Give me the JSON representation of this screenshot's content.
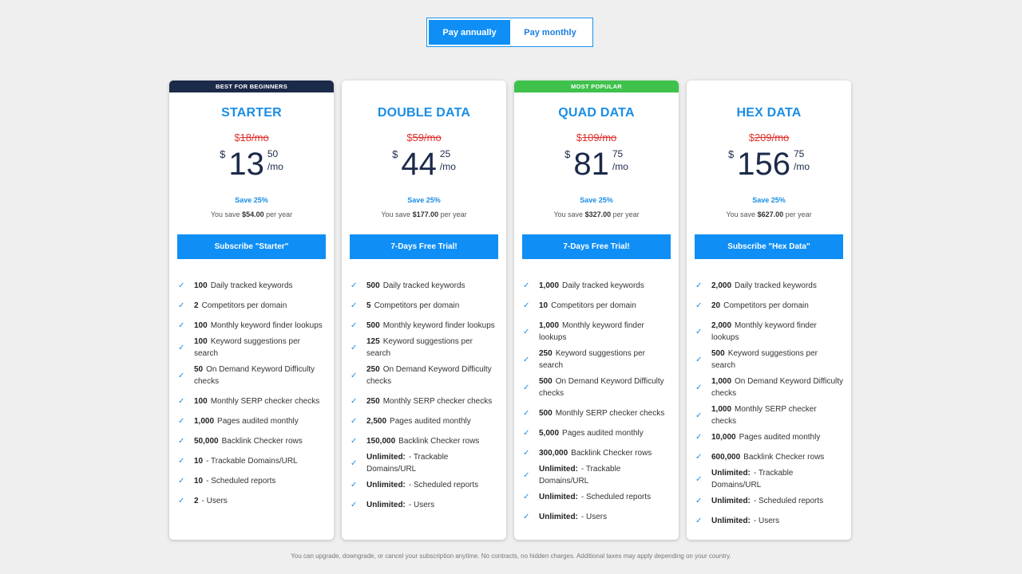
{
  "toggle": {
    "annual": "Pay annually",
    "monthly": "Pay monthly"
  },
  "plans": [
    {
      "ribbon": "BEST FOR BEGINNERS",
      "ribbon_style": "dark",
      "name": "STARTER",
      "old_currency": "$",
      "old_price": "18/mo",
      "currency": "$",
      "price": "13",
      "cents": "50",
      "per": "/mo",
      "save_pct": "Save 25%",
      "save_prefix": "You save",
      "save_amount": "$54.00",
      "save_suffix": "per year",
      "cta": "Subscribe \"Starter\"",
      "features": [
        {
          "n": "100",
          "t": "Daily tracked keywords"
        },
        {
          "n": "2",
          "t": "Competitors per domain"
        },
        {
          "n": "100",
          "t": "Monthly keyword finder lookups"
        },
        {
          "n": "100",
          "t": "Keyword suggestions per search"
        },
        {
          "n": "50",
          "t": "On Demand Keyword Difficulty checks"
        },
        {
          "n": "100",
          "t": "Monthly SERP checker checks"
        },
        {
          "n": "1,000",
          "t": "Pages audited monthly"
        },
        {
          "n": "50,000",
          "t": "Backlink Checker rows"
        },
        {
          "n": "10",
          "t": "- Trackable Domains/URL"
        },
        {
          "n": "10",
          "t": "- Scheduled reports"
        },
        {
          "n": "2",
          "t": "- Users"
        }
      ]
    },
    {
      "ribbon": "",
      "ribbon_style": "none",
      "name": "DOUBLE DATA",
      "old_currency": "$",
      "old_price": "59/mo",
      "currency": "$",
      "price": "44",
      "cents": "25",
      "per": "/mo",
      "save_pct": "Save 25%",
      "save_prefix": "You save",
      "save_amount": "$177.00",
      "save_suffix": "per year",
      "cta": "7-Days Free Trial!",
      "features": [
        {
          "n": "500",
          "t": "Daily tracked keywords"
        },
        {
          "n": "5",
          "t": "Competitors per domain"
        },
        {
          "n": "500",
          "t": "Monthly keyword finder lookups"
        },
        {
          "n": "125",
          "t": "Keyword suggestions per search"
        },
        {
          "n": "250",
          "t": "On Demand Keyword Difficulty checks"
        },
        {
          "n": "250",
          "t": "Monthly SERP checker checks"
        },
        {
          "n": "2,500",
          "t": "Pages audited monthly"
        },
        {
          "n": "150,000",
          "t": "Backlink Checker rows"
        },
        {
          "n": "Unlimited:",
          "t": "- Trackable Domains/URL"
        },
        {
          "n": "Unlimited:",
          "t": "- Scheduled reports"
        },
        {
          "n": "Unlimited:",
          "t": "- Users"
        }
      ]
    },
    {
      "ribbon": "MOST POPULAR",
      "ribbon_style": "green",
      "name": "QUAD DATA",
      "old_currency": "$",
      "old_price": "109/mo",
      "currency": "$",
      "price": "81",
      "cents": "75",
      "per": "/mo",
      "save_pct": "Save 25%",
      "save_prefix": "You save",
      "save_amount": "$327.00",
      "save_suffix": "per year",
      "cta": "7-Days Free Trial!",
      "features": [
        {
          "n": "1,000",
          "t": "Daily tracked keywords"
        },
        {
          "n": "10",
          "t": "Competitors per domain"
        },
        {
          "n": "1,000",
          "t": "Monthly keyword finder lookups"
        },
        {
          "n": "250",
          "t": "Keyword suggestions per search"
        },
        {
          "n": "500",
          "t": "On Demand Keyword Difficulty checks"
        },
        {
          "n": "500",
          "t": "Monthly SERP checker checks"
        },
        {
          "n": "5,000",
          "t": "Pages audited monthly"
        },
        {
          "n": "300,000",
          "t": "Backlink Checker rows"
        },
        {
          "n": "Unlimited:",
          "t": "- Trackable Domains/URL"
        },
        {
          "n": "Unlimited:",
          "t": "- Scheduled reports"
        },
        {
          "n": "Unlimited:",
          "t": "- Users"
        }
      ]
    },
    {
      "ribbon": "",
      "ribbon_style": "none",
      "name": "HEX DATA",
      "old_currency": "$",
      "old_price": "209/mo",
      "currency": "$",
      "price": "156",
      "cents": "75",
      "per": "/mo",
      "save_pct": "Save 25%",
      "save_prefix": "You save",
      "save_amount": "$627.00",
      "save_suffix": "per year",
      "cta": "Subscribe \"Hex Data\"",
      "features": [
        {
          "n": "2,000",
          "t": "Daily tracked keywords"
        },
        {
          "n": "20",
          "t": "Competitors per domain"
        },
        {
          "n": "2,000",
          "t": "Monthly keyword finder lookups"
        },
        {
          "n": "500",
          "t": "Keyword suggestions per search"
        },
        {
          "n": "1,000",
          "t": "On Demand Keyword Difficulty checks"
        },
        {
          "n": "1,000",
          "t": "Monthly SERP checker checks"
        },
        {
          "n": "10,000",
          "t": "Pages audited monthly"
        },
        {
          "n": "600,000",
          "t": "Backlink Checker rows"
        },
        {
          "n": "Unlimited:",
          "t": "- Trackable Domains/URL"
        },
        {
          "n": "Unlimited:",
          "t": "- Scheduled reports"
        },
        {
          "n": "Unlimited:",
          "t": "- Users"
        }
      ]
    }
  ],
  "footer": "You can upgrade, downgrade, or cancel your subscription anytime. No contracts, no hidden charges. Additional taxes may apply depending on your country.",
  "colors": {
    "accent": "#0f8ff5",
    "dark": "#1c2a4a",
    "green": "#3ec24b",
    "old_price": "#e0322e"
  },
  "icons": {
    "feature_check": "check-icon"
  }
}
